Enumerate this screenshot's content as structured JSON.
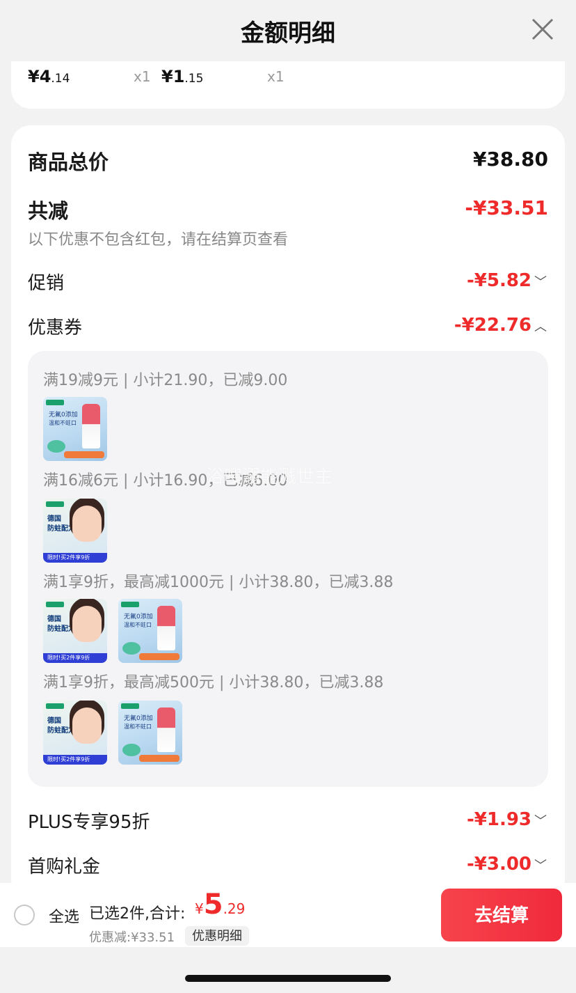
{
  "header": {
    "title": "金额明细"
  },
  "top_items": [
    {
      "price_int": "¥4",
      "price_dec": ".14",
      "qty": "x1"
    },
    {
      "price_int": "¥1",
      "price_dec": ".15",
      "qty": "x1"
    }
  ],
  "summary": {
    "goods_total_label": "商品总价",
    "goods_total_value": "¥38.80",
    "reduce_label": "共减",
    "reduce_value": "-¥33.51",
    "note": "以下优惠不包含红包，请在结算页查看",
    "promo_label": "促销",
    "promo_value": "-¥5.82",
    "coupon_label": "优惠券",
    "coupon_value": "-¥22.76",
    "plus_label": "PLUS专享95折",
    "plus_value": "-¥1.93",
    "first_label": "首购礼金",
    "first_value": "-¥3.00"
  },
  "coupons": [
    {
      "text": "满19减9元 | 小计21.90，已减9.00",
      "items": [
        "toothpaste-product-icon"
      ]
    },
    {
      "text": "满16减6元 | 小计16.90，已减6.00",
      "items": [
        "kid-toothpaste-product-icon"
      ]
    },
    {
      "text": "满1享9折，最高减1000元 | 小计38.80，已减3.88",
      "items": [
        "kid-toothpaste-product-icon",
        "toothpaste-product-icon"
      ]
    },
    {
      "text": "满1享9折，最高减500元 | 小计38.80，已减3.88",
      "items": [
        "kid-toothpaste-product-icon",
        "toothpaste-product-icon"
      ]
    }
  ],
  "thumb_text": {
    "a1": "无氟0添加",
    "a2": "温和不蛀口",
    "b1": "德国",
    "b2": "防蛀配方",
    "b3": "限时!买2件享9折"
  },
  "watermark": "浴嗖溺能溅世主",
  "bottom_bar": {
    "select_all": "全选",
    "selected": "已选2件,合计:",
    "currency": "¥",
    "total_int": "5",
    "total_dec": ".29",
    "discount": "优惠减:¥33.51",
    "detail_button": "优惠明细",
    "checkout": "去结算"
  },
  "colors": {
    "accent_red": "#ee2a2a",
    "card_bg": "#ffffff",
    "page_bg": "#f2f2f2"
  }
}
